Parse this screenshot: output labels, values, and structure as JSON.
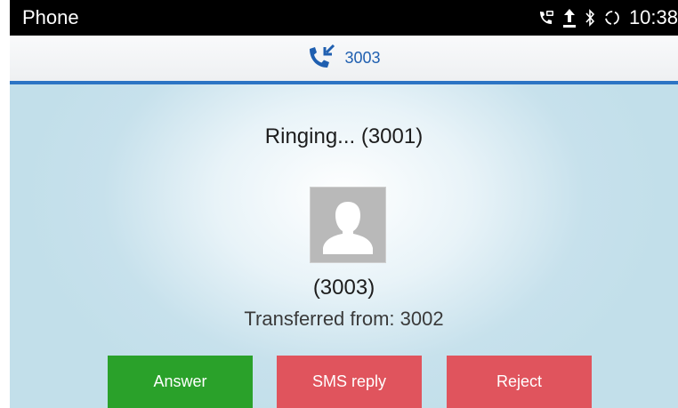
{
  "status_bar": {
    "title": "Phone",
    "time": "10:38",
    "icons": [
      "call-forward-icon",
      "upload-icon",
      "bluetooth-icon",
      "sync-icon"
    ]
  },
  "call_header": {
    "icon": "incoming-call-icon",
    "number": "3003"
  },
  "call": {
    "ringing_text": "Ringing... (3001)",
    "caller_number": "(3003)",
    "transfer_text": "Transferred from: 3002",
    "avatar_icon": "contact-placeholder-icon"
  },
  "actions": {
    "answer_label": "Answer",
    "sms_label": "SMS reply",
    "reject_label": "Reject"
  },
  "colors": {
    "header_accent": "#2c74c4",
    "answer": "#2aa12a",
    "reject": "#e0545d",
    "sms": "#e0545d",
    "number_text": "#1f5fb0"
  }
}
